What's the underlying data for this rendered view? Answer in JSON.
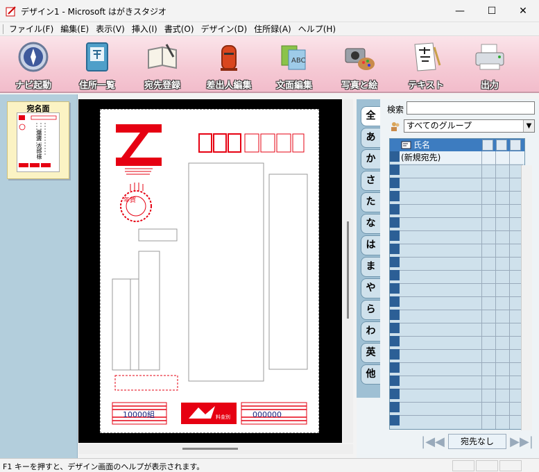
{
  "window": {
    "title": "デザイン1 - Microsoft はがきスタジオ",
    "minimize": "—",
    "maximize": "☐",
    "close": "✕"
  },
  "menu": [
    "ファイル(F)",
    "編集(E)",
    "表示(V)",
    "挿入(I)",
    "書式(O)",
    "デザイン(D)",
    "住所録(A)",
    "ヘルプ(H)"
  ],
  "toolbar": {
    "buttons": [
      {
        "label": "ナビ起動",
        "icon": "compass-icon"
      },
      {
        "label": "住所一覧",
        "icon": "address-book-icon"
      },
      {
        "label": "宛先登録",
        "icon": "register-book-icon"
      },
      {
        "label": "差出人編集",
        "icon": "mailbox-icon"
      },
      {
        "label": "文面編集",
        "icon": "document-edit-icon"
      },
      {
        "label": "写真と絵",
        "icon": "camera-palette-icon"
      },
      {
        "label": "テキスト",
        "icon": "text-brush-icon"
      },
      {
        "label": "出力",
        "icon": "printer-icon"
      }
    ]
  },
  "left_panel": {
    "thumb_title": "宛名面",
    "mini_name": "葉書 太郎様"
  },
  "postcard": {
    "lottery_left": "10000組",
    "lottery_right": "000000",
    "stamp_label": "年賀",
    "fee_label": "料金別"
  },
  "index_tabs": [
    "全",
    "あ",
    "か",
    "さ",
    "た",
    "な",
    "は",
    "ま",
    "や",
    "ら",
    "わ",
    "英",
    "他"
  ],
  "address_book": {
    "search_label": "検索",
    "search_value": "",
    "group_selected": "すべてのグループ",
    "column_name": "氏名",
    "new_entry": "(新規宛先)",
    "nav_status": "宛先なし"
  },
  "status": {
    "text": "F1 キーを押すと、デザイン画面のヘルプが表示されます。"
  },
  "colors": {
    "toolbar_pink": "#f5c9d4",
    "postcard_red": "#e60012",
    "panel_blue": "#b3cedc",
    "header_blue": "#3d7cc0"
  }
}
